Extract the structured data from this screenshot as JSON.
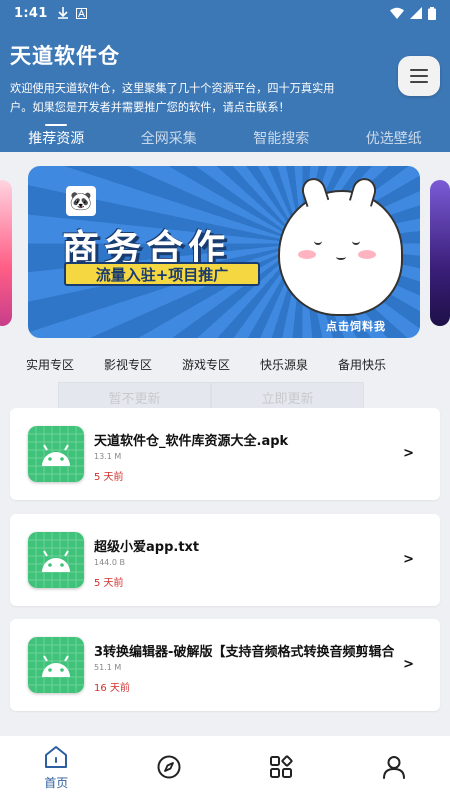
{
  "status_bar": {
    "time": "1:41",
    "notif_icons": [
      "download-icon",
      "a-icon"
    ],
    "right_icons": [
      "wifi-icon",
      "signal-icon",
      "battery-icon"
    ]
  },
  "header": {
    "title": "天道软件仓",
    "welcome_line1": "欢迎使用天道软件仓，这里聚集了几十个资源平台，四十万真实用",
    "welcome_line2": "户。如果您是开发者并需要推广您的软件，请点击联系！"
  },
  "tabs": [
    {
      "label": "推荐资源",
      "active": true
    },
    {
      "label": "全网采集",
      "active": false
    },
    {
      "label": "智能搜索",
      "active": false
    },
    {
      "label": "优选壁纸",
      "active": false
    }
  ],
  "banner": {
    "headline": "商务合作",
    "strip": "流量入驻+项目推广",
    "cta": "点击饲料我"
  },
  "categories": [
    "实用专区",
    "影视专区",
    "游戏专区",
    "快乐源泉",
    "备用快乐"
  ],
  "update_buttons": {
    "later": "暂不更新",
    "now": "立即更新"
  },
  "files": [
    {
      "name": "天道软件仓_软件库资源大全.apk",
      "size": "13.1 M",
      "time": "5 天前"
    },
    {
      "name": "超级小爱app.txt",
      "size": "144.0 B",
      "time": "5 天前"
    },
    {
      "name": "3转换编辑器-破解版【支持音频格式转换音频剪辑合",
      "size": "51.1 M",
      "time": "16 天前"
    }
  ],
  "bottom_nav": [
    {
      "label": "首页",
      "icon": "home-icon",
      "active": true
    },
    {
      "label": "",
      "icon": "compass-icon",
      "active": false
    },
    {
      "label": "",
      "icon": "apps-icon",
      "active": false
    },
    {
      "label": "",
      "icon": "user-icon",
      "active": false
    }
  ],
  "colors": {
    "header_bg": "#3d78b6",
    "accent": "#2d5fa0",
    "time_red": "#d0312d",
    "app_icon_green": "#3fc37a"
  }
}
